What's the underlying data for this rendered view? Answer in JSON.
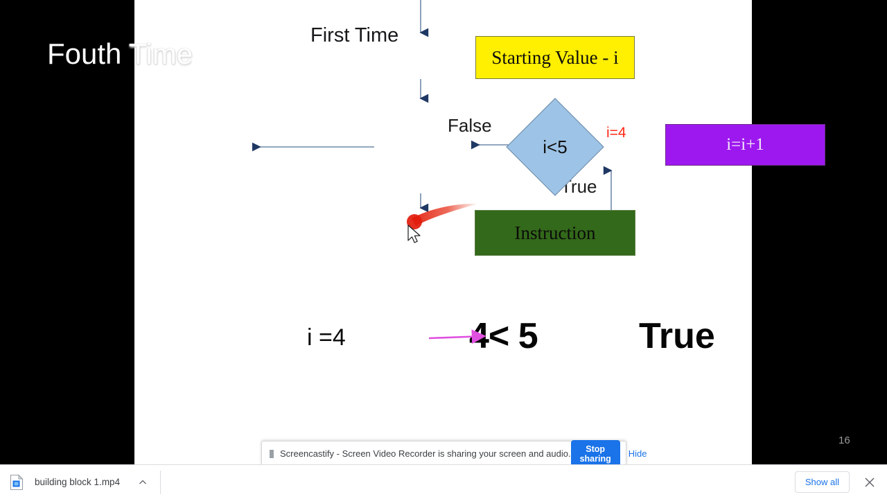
{
  "slide": {
    "overlay_title_visible": "Fouth",
    "overlay_title_ghost": " Time",
    "heading": "First Time",
    "page_number": "16",
    "flow": {
      "start_box": "Starting Value - i",
      "decision": "i<5",
      "increment_box": "i=i+1",
      "instruction_box": "Instruction",
      "label_false": "False",
      "label_true": "True",
      "annotation_i_equals": "i=4"
    },
    "statement": {
      "variable": "i =4",
      "expression": "4< 5",
      "result": "True"
    },
    "colors": {
      "start_box": "#ffef00",
      "decision": "#9dc3e6",
      "increment_box": "#9d18ef",
      "instruction_box": "#33691a",
      "annotation_red": "#ff2a17",
      "arrow_magenta": "#e050e0",
      "connector": "#6f8aa8"
    }
  },
  "share_notification": {
    "message": "Screencastify - Screen Video Recorder is sharing your screen and audio.",
    "stop_label": "Stop sharing",
    "hide_label": "Hide"
  },
  "download_shelf": {
    "filename": "building block 1.mp4",
    "show_all_label": "Show all"
  }
}
